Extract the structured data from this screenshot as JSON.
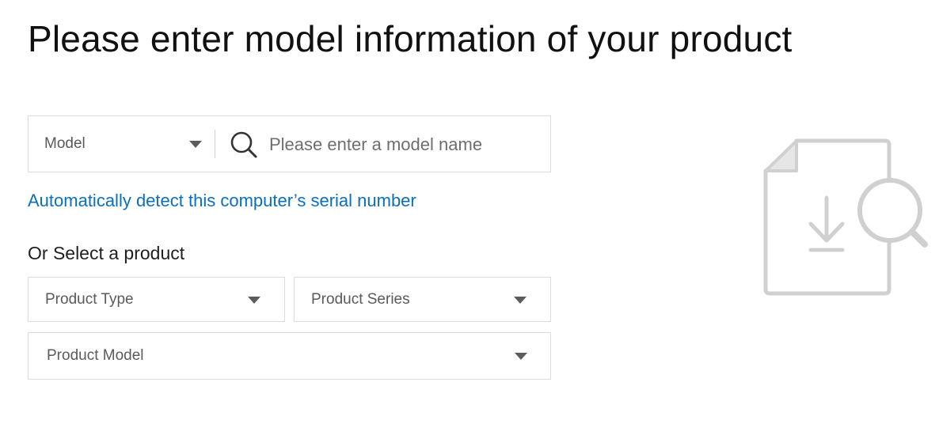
{
  "header": {
    "title": "Please enter model information of your product"
  },
  "search": {
    "type_select_value": "Model",
    "placeholder": "Please enter a model name",
    "value": ""
  },
  "auto_detect": {
    "link_text": "Automatically detect this computer’s serial number"
  },
  "product_selector": {
    "heading": "Or Select a product",
    "product_type": "Product Type",
    "product_series": "Product Series",
    "product_model": "Product Model"
  },
  "icons": {
    "dropdown": "caret-down-icon",
    "search": "search-icon",
    "illustration": "document-download-search-icon"
  },
  "colors": {
    "link": "#0a6fc2",
    "border": "#dcdcdc",
    "illustration": "#d0d0d0"
  }
}
